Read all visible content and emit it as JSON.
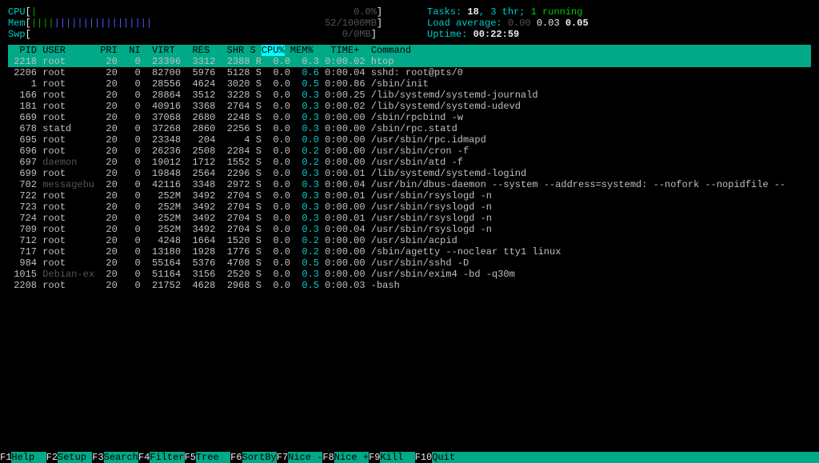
{
  "meters": {
    "cpu": {
      "label": "CPU",
      "bar": "|",
      "value": "0.0%"
    },
    "mem": {
      "label": "Mem",
      "bar_g": "||||",
      "bar_b": "|||||||||||||||||",
      "value": "52/1000MB"
    },
    "swp": {
      "label": "Swp",
      "value": "0/0MB"
    }
  },
  "sysinfo": {
    "tasks_label": "Tasks: ",
    "tasks_value": "18",
    "tasks_thr": ", 3 thr; ",
    "tasks_running": "1 running",
    "load_label": "Load average: ",
    "load_values": "0.00 0.03 0.05",
    "uptime_label": "Uptime: ",
    "uptime_value": "00:22:59"
  },
  "columns": "  PID USER      PRI  NI  VIRT   RES   SHR S CPU% MEM%   TIME+  Command",
  "sort_col_label": "CPU%",
  "processes": [
    {
      "sel": true,
      "pid": "2218",
      "user": "root",
      "pri": "20",
      "ni": "0",
      "virt": "23396",
      "res": "3312",
      "shr": "2388",
      "s": "R",
      "cpu": "0.0",
      "mem": "0.3",
      "time": "0:00.02",
      "cmd": "htop"
    },
    {
      "pid": "2206",
      "user": "root",
      "pri": "20",
      "ni": "0",
      "virt": "82700",
      "res": "5976",
      "shr": "5128",
      "s": "S",
      "cpu": "0.0",
      "mem": "0.6",
      "time": "0:00.04",
      "cmd": "sshd: root@pts/0"
    },
    {
      "pid": "1",
      "user": "root",
      "pri": "20",
      "ni": "0",
      "virt": "28556",
      "res": "4624",
      "shr": "3020",
      "s": "S",
      "cpu": "0.0",
      "mem": "0.5",
      "time": "0:00.86",
      "cmd": "/sbin/init"
    },
    {
      "pid": "166",
      "user": "root",
      "pri": "20",
      "ni": "0",
      "virt": "28864",
      "res": "3512",
      "shr": "3228",
      "s": "S",
      "cpu": "0.0",
      "mem": "0.3",
      "time": "0:00.25",
      "cmd": "/lib/systemd/systemd-journald"
    },
    {
      "pid": "181",
      "user": "root",
      "pri": "20",
      "ni": "0",
      "virt": "40916",
      "res": "3368",
      "shr": "2764",
      "s": "S",
      "cpu": "0.0",
      "mem": "0.3",
      "time": "0:00.02",
      "cmd": "/lib/systemd/systemd-udevd"
    },
    {
      "pid": "669",
      "user": "root",
      "pri": "20",
      "ni": "0",
      "virt": "37068",
      "res": "2680",
      "shr": "2248",
      "s": "S",
      "cpu": "0.0",
      "mem": "0.3",
      "time": "0:00.00",
      "cmd": "/sbin/rpcbind -w"
    },
    {
      "pid": "678",
      "user": "statd",
      "pri": "20",
      "ni": "0",
      "virt": "37268",
      "res": "2860",
      "shr": "2256",
      "s": "S",
      "cpu": "0.0",
      "mem": "0.3",
      "time": "0:00.00",
      "cmd": "/sbin/rpc.statd"
    },
    {
      "pid": "695",
      "user": "root",
      "pri": "20",
      "ni": "0",
      "virt": "23348",
      "res": "204",
      "shr": "4",
      "s": "S",
      "cpu": "0.0",
      "mem": "0.0",
      "time": "0:00.00",
      "cmd": "/usr/sbin/rpc.idmapd"
    },
    {
      "pid": "696",
      "user": "root",
      "pri": "20",
      "ni": "0",
      "virt": "26236",
      "res": "2508",
      "shr": "2284",
      "s": "S",
      "cpu": "0.0",
      "mem": "0.2",
      "time": "0:00.00",
      "cmd": "/usr/sbin/cron -f"
    },
    {
      "pid": "697",
      "user": "daemon",
      "pri": "20",
      "ni": "0",
      "virt": "19012",
      "res": "1712",
      "shr": "1552",
      "s": "S",
      "cpu": "0.0",
      "mem": "0.2",
      "time": "0:00.00",
      "cmd": "/usr/sbin/atd -f",
      "dimuser": true
    },
    {
      "pid": "699",
      "user": "root",
      "pri": "20",
      "ni": "0",
      "virt": "19848",
      "res": "2564",
      "shr": "2296",
      "s": "S",
      "cpu": "0.0",
      "mem": "0.3",
      "time": "0:00.01",
      "cmd": "/lib/systemd/systemd-logind"
    },
    {
      "pid": "702",
      "user": "messagebu",
      "pri": "20",
      "ni": "0",
      "virt": "42116",
      "res": "3348",
      "shr": "2972",
      "s": "S",
      "cpu": "0.0",
      "mem": "0.3",
      "time": "0:00.04",
      "cmd": "/usr/bin/dbus-daemon --system --address=systemd: --nofork --nopidfile --",
      "dimuser": true
    },
    {
      "pid": "722",
      "user": "root",
      "pri": "20",
      "ni": "0",
      "virt": "252M",
      "res": "3492",
      "shr": "2704",
      "s": "S",
      "cpu": "0.0",
      "mem": "0.3",
      "time": "0:00.01",
      "cmd": "/usr/sbin/rsyslogd -n"
    },
    {
      "pid": "723",
      "user": "root",
      "pri": "20",
      "ni": "0",
      "virt": "252M",
      "res": "3492",
      "shr": "2704",
      "s": "S",
      "cpu": "0.0",
      "mem": "0.3",
      "time": "0:00.00",
      "cmd": "/usr/sbin/rsyslogd -n"
    },
    {
      "pid": "724",
      "user": "root",
      "pri": "20",
      "ni": "0",
      "virt": "252M",
      "res": "3492",
      "shr": "2704",
      "s": "S",
      "cpu": "0.0",
      "mem": "0.3",
      "time": "0:00.01",
      "cmd": "/usr/sbin/rsyslogd -n"
    },
    {
      "pid": "709",
      "user": "root",
      "pri": "20",
      "ni": "0",
      "virt": "252M",
      "res": "3492",
      "shr": "2704",
      "s": "S",
      "cpu": "0.0",
      "mem": "0.3",
      "time": "0:00.04",
      "cmd": "/usr/sbin/rsyslogd -n"
    },
    {
      "pid": "712",
      "user": "root",
      "pri": "20",
      "ni": "0",
      "virt": "4248",
      "res": "1664",
      "shr": "1520",
      "s": "S",
      "cpu": "0.0",
      "mem": "0.2",
      "time": "0:00.00",
      "cmd": "/usr/sbin/acpid"
    },
    {
      "pid": "717",
      "user": "root",
      "pri": "20",
      "ni": "0",
      "virt": "13180",
      "res": "1928",
      "shr": "1776",
      "s": "S",
      "cpu": "0.0",
      "mem": "0.2",
      "time": "0:00.00",
      "cmd": "/sbin/agetty --noclear tty1 linux"
    },
    {
      "pid": "984",
      "user": "root",
      "pri": "20",
      "ni": "0",
      "virt": "55164",
      "res": "5376",
      "shr": "4708",
      "s": "S",
      "cpu": "0.0",
      "mem": "0.5",
      "time": "0:00.00",
      "cmd": "/usr/sbin/sshd -D"
    },
    {
      "pid": "1015",
      "user": "Debian-ex",
      "pri": "20",
      "ni": "0",
      "virt": "51164",
      "res": "3156",
      "shr": "2520",
      "s": "S",
      "cpu": "0.0",
      "mem": "0.3",
      "time": "0:00.00",
      "cmd": "/usr/sbin/exim4 -bd -q30m",
      "dimuser": true
    },
    {
      "pid": "2208",
      "user": "root",
      "pri": "20",
      "ni": "0",
      "virt": "21752",
      "res": "4628",
      "shr": "2968",
      "s": "S",
      "cpu": "0.0",
      "mem": "0.5",
      "time": "0:00.03",
      "cmd": "-bash"
    }
  ],
  "fkeys": [
    {
      "k": "F1",
      "l": "Help  "
    },
    {
      "k": "F2",
      "l": "Setup "
    },
    {
      "k": "F3",
      "l": "Search"
    },
    {
      "k": "F4",
      "l": "Filter"
    },
    {
      "k": "F5",
      "l": "Tree  "
    },
    {
      "k": "F6",
      "l": "SortBy"
    },
    {
      "k": "F7",
      "l": "Nice -"
    },
    {
      "k": "F8",
      "l": "Nice +"
    },
    {
      "k": "F9",
      "l": "Kill  "
    },
    {
      "k": "F10",
      "l": "Quit  "
    }
  ]
}
